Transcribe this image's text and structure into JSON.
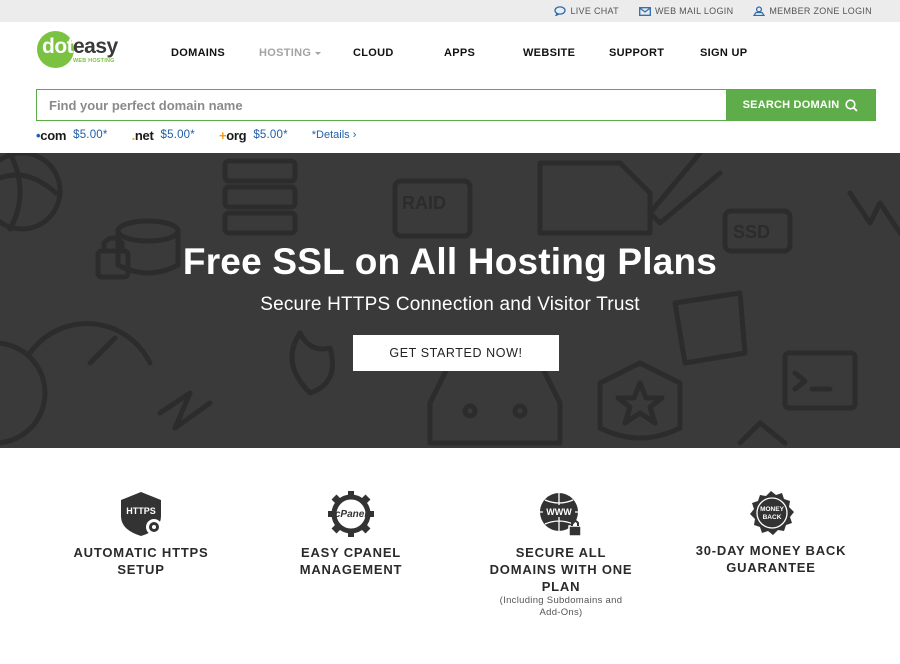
{
  "topbar": {
    "links": [
      {
        "label": "LIVE CHAT",
        "icon": "chat-icon"
      },
      {
        "label": "WEB MAIL LOGIN",
        "icon": "mail-icon"
      },
      {
        "label": "MEMBER ZONE LOGIN",
        "icon": "user-icon"
      }
    ]
  },
  "logo": {
    "part1": "dot",
    "part2": "easy",
    "tagline": "WEB HOSTING"
  },
  "nav": {
    "domains": "DOMAINS",
    "hosting": "HOSTING",
    "cloud": "CLOUD",
    "apps": "APPS",
    "website": "WEBSITE",
    "support": "SUPPORT",
    "signup": "SIGN UP"
  },
  "search": {
    "placeholder": "Find your perfect domain name",
    "button_label": "SEARCH DOMAIN"
  },
  "tlds": [
    {
      "prefix": "•",
      "name": "com",
      "price": "$5.00*"
    },
    {
      "prefix": ".",
      "name": "net",
      "price": "$5.00*"
    },
    {
      "prefix": "+",
      "name": "org",
      "price": "$5.00*"
    }
  ],
  "details_link": "*Details ›",
  "hero": {
    "title": "Free SSL on All Hosting Plans",
    "subtitle": "Secure HTTPS Connection and Visitor Trust",
    "cta": "GET STARTED NOW!"
  },
  "features": [
    {
      "icon": "https-shield-icon",
      "badge": "HTTPS",
      "title_l1": "AUTOMATIC HTTPS",
      "title_l2": "SETUP"
    },
    {
      "icon": "cpanel-gear-icon",
      "badge": "cPanel",
      "title_l1": "EASY CPANEL",
      "title_l2": "MANAGEMENT"
    },
    {
      "icon": "www-globe-lock-icon",
      "badge": "WWW",
      "title_l1": "SECURE ALL",
      "title_l2": "DOMAINS WITH ONE",
      "title_l3": "PLAN",
      "note_l1": "(Including Subdomains and",
      "note_l2": "Add-Ons)"
    },
    {
      "icon": "money-back-badge-icon",
      "badge_l1": "MONEY",
      "badge_l2": "BACK",
      "title_l1": "30-DAY MONEY BACK",
      "title_l2": "GUARANTEE"
    }
  ],
  "colors": {
    "brand_green": "#7cc242",
    "button_green": "#5fad4a",
    "hero_bg": "#3a3a3a",
    "link_blue": "#1f5fa8"
  }
}
